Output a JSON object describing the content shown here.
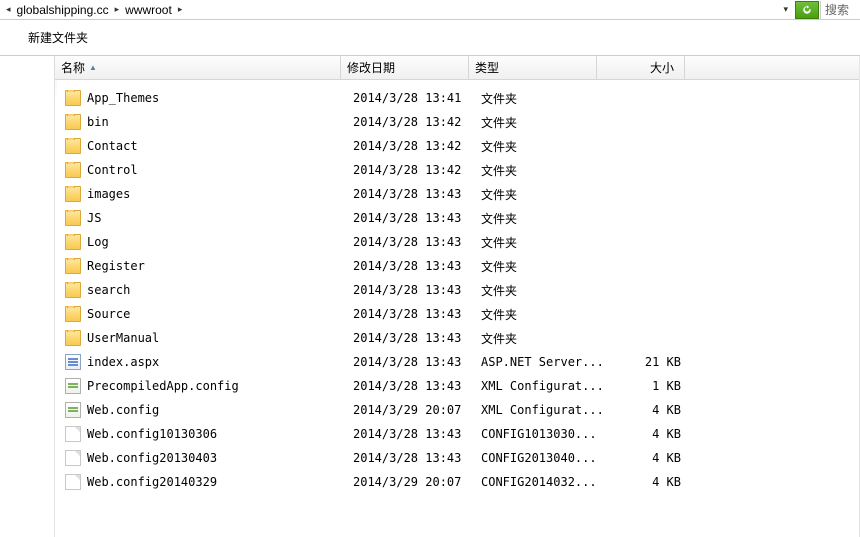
{
  "breadcrumb": {
    "segments": [
      "globalshipping.cc",
      "wwwroot"
    ],
    "search_placeholder": "搜索"
  },
  "toolbar": {
    "new_folder_label": "新建文件夹"
  },
  "columns": {
    "name": "名称",
    "date": "修改日期",
    "type": "类型",
    "size": "大小"
  },
  "file_types": {
    "folder": "文件夹",
    "aspnet": "ASP.NET Server...",
    "xmlconfig": "XML Configurat...",
    "config1013": "CONFIG1013030...",
    "config20130403": "CONFIG2013040...",
    "config20140329": "CONFIG2014032..."
  },
  "rows": [
    {
      "icon": "folder",
      "name": "App_Themes",
      "date": "2014/3/28 13:41",
      "typeKey": "folder",
      "size": ""
    },
    {
      "icon": "folder",
      "name": "bin",
      "date": "2014/3/28 13:42",
      "typeKey": "folder",
      "size": ""
    },
    {
      "icon": "folder",
      "name": "Contact",
      "date": "2014/3/28 13:42",
      "typeKey": "folder",
      "size": ""
    },
    {
      "icon": "folder",
      "name": "Control",
      "date": "2014/3/28 13:42",
      "typeKey": "folder",
      "size": ""
    },
    {
      "icon": "folder",
      "name": "images",
      "date": "2014/3/28 13:43",
      "typeKey": "folder",
      "size": ""
    },
    {
      "icon": "folder",
      "name": "JS",
      "date": "2014/3/28 13:43",
      "typeKey": "folder",
      "size": ""
    },
    {
      "icon": "folder",
      "name": "Log",
      "date": "2014/3/28 13:43",
      "typeKey": "folder",
      "size": ""
    },
    {
      "icon": "folder",
      "name": "Register",
      "date": "2014/3/28 13:43",
      "typeKey": "folder",
      "size": ""
    },
    {
      "icon": "folder",
      "name": "search",
      "date": "2014/3/28 13:43",
      "typeKey": "folder",
      "size": ""
    },
    {
      "icon": "folder",
      "name": "Source",
      "date": "2014/3/28 13:43",
      "typeKey": "folder",
      "size": ""
    },
    {
      "icon": "folder",
      "name": "UserManual",
      "date": "2014/3/28 13:43",
      "typeKey": "folder",
      "size": ""
    },
    {
      "icon": "aspx",
      "name": "index.aspx",
      "date": "2014/3/28 13:43",
      "typeKey": "aspnet",
      "size": "21 KB"
    },
    {
      "icon": "config",
      "name": "PrecompiledApp.config",
      "date": "2014/3/28 13:43",
      "typeKey": "xmlconfig",
      "size": "1 KB"
    },
    {
      "icon": "config",
      "name": "Web.config",
      "date": "2014/3/29 20:07",
      "typeKey": "xmlconfig",
      "size": "4 KB"
    },
    {
      "icon": "oldconfig",
      "name": "Web.config10130306",
      "date": "2014/3/28 13:43",
      "typeKey": "config1013",
      "size": "4 KB"
    },
    {
      "icon": "oldconfig",
      "name": "Web.config20130403",
      "date": "2014/3/28 13:43",
      "typeKey": "config20130403",
      "size": "4 KB"
    },
    {
      "icon": "oldconfig",
      "name": "Web.config20140329",
      "date": "2014/3/29 20:07",
      "typeKey": "config20140329",
      "size": "4 KB"
    }
  ]
}
